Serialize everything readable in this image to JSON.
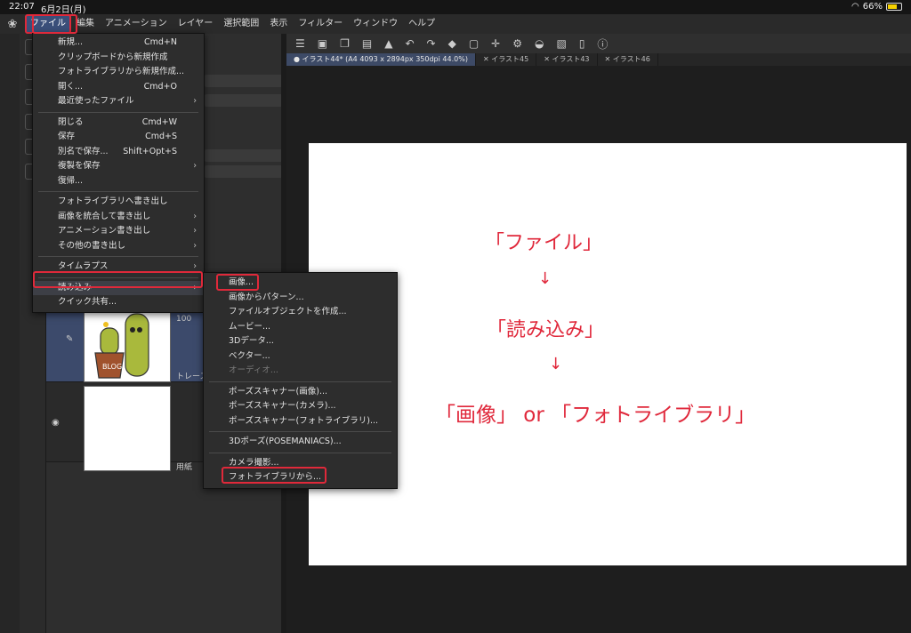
{
  "status": {
    "time": "22:07",
    "date": "6月2日(月)",
    "battery": "66%"
  },
  "menubar": [
    "ファイル",
    "編集",
    "アニメーション",
    "レイヤー",
    "選択範囲",
    "表示",
    "フィルター",
    "ウィンドウ",
    "ヘルプ"
  ],
  "tabs": [
    "イラスト44* (A4 4093 x 2894px 350dpi 44.0%)",
    "イラスト45",
    "イラスト43",
    "イラスト46"
  ],
  "file_menu": {
    "items": [
      {
        "label": "新規...",
        "shortcut": "Cmd+N"
      },
      {
        "label": "クリップボードから新規作成"
      },
      {
        "label": "フォトライブラリから新規作成..."
      },
      {
        "label": "開く...",
        "shortcut": "Cmd+O"
      },
      {
        "label": "最近使ったファイル",
        "submenu": true
      },
      {
        "sep": true
      },
      {
        "label": "閉じる",
        "shortcut": "Cmd+W"
      },
      {
        "label": "保存",
        "shortcut": "Cmd+S"
      },
      {
        "label": "別名で保存...",
        "shortcut": "Shift+Opt+S"
      },
      {
        "label": "複製を保存",
        "submenu": true
      },
      {
        "label": "復帰..."
      },
      {
        "sep": true
      },
      {
        "label": "フォトライブラリへ書き出し"
      },
      {
        "label": "画像を統合して書き出し",
        "submenu": true
      },
      {
        "label": "アニメーション書き出し",
        "submenu": true
      },
      {
        "label": "その他の書き出し",
        "submenu": true
      },
      {
        "sep": true
      },
      {
        "label": "タイムラプス",
        "submenu": true
      },
      {
        "sep": true
      },
      {
        "label": "読み込み",
        "submenu": true,
        "highlight": true
      },
      {
        "label": "クイック共有..."
      }
    ]
  },
  "import_menu": {
    "items": [
      {
        "label": "画像..."
      },
      {
        "label": "画像からパターン..."
      },
      {
        "label": "ファイルオブジェクトを作成..."
      },
      {
        "label": "ムービー..."
      },
      {
        "label": "3Dデータ..."
      },
      {
        "label": "ベクター..."
      },
      {
        "label": "オーディオ...",
        "disabled": true
      },
      {
        "sep": true
      },
      {
        "label": "ポーズスキャナー(画像)..."
      },
      {
        "label": "ポーズスキャナー(カメラ)..."
      },
      {
        "label": "ポーズスキャナー(フォトライブラリ)..."
      },
      {
        "sep": true
      },
      {
        "label": "3Dポーズ(POSEMANIACS)..."
      },
      {
        "sep": true
      },
      {
        "label": "カメラ撮影..."
      },
      {
        "label": "フォトライブラリから..."
      }
    ]
  },
  "layers": [
    {
      "name": "トレース",
      "opacity": "100"
    },
    {
      "name": "用紙"
    }
  ],
  "annotation": {
    "line1": "「ファイル」",
    "arrow1": "↓",
    "line2": "「読み込み」",
    "arrow2": "↓",
    "line3": "「画像」 or 「フォトライブラリ」"
  },
  "colors": {
    "annotation": "#e0283b",
    "selection": "#3b4f7a"
  }
}
